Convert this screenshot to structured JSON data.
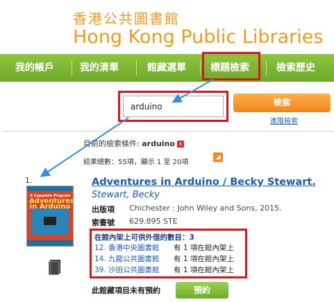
{
  "header": {
    "title_zh": "香港公共圖書館",
    "title_en": "Hong Kong Public Libraries"
  },
  "nav": {
    "items": [
      {
        "label": "我的帳戶"
      },
      {
        "label": "我的清單"
      },
      {
        "label": "館藏選單"
      },
      {
        "label": "標題檢索"
      },
      {
        "label": "檢索歷史"
      }
    ]
  },
  "search": {
    "value": "arduino",
    "button_label": "檢索",
    "advanced_label": "進階檢索"
  },
  "criteria": {
    "prefix": "目前的檢索條件:",
    "term": "arduino",
    "clear_icon": "x"
  },
  "summary": "結果總數：55項，顯示 1 至 20項",
  "result": {
    "number": "1.",
    "title": "Adventures in Arduino / Becky Stewart.",
    "author": "Stewart, Becky",
    "publisher_label": "出版項",
    "publisher_value": "Chichester : John Wiley and Sons, 2015.",
    "callno_label": "索書號",
    "callno_value": "629.895 STE",
    "cover": {
      "top_text": "A Complete Program",
      "big_text": "Adventures in Arduino"
    },
    "availability": {
      "heading": "在館內架上可供外借的數目：3",
      "branches": [
        {
          "branch": "12. 香港中央圖書館",
          "status": "有 1 項在館內架上"
        },
        {
          "branch": "14. 九龍公共圖書館",
          "status": "有 1 項在館內架上"
        },
        {
          "branch": "39. 沙田公共圖書館",
          "status": "有 1 項在館內架上"
        }
      ]
    },
    "hold_note": "此館藏項目未有預約",
    "reserve_label": "預約"
  },
  "colors": {
    "brand_orange": "#f39a1d",
    "nav_green": "#7db836",
    "highlight_red": "#e0151c",
    "link_blue": "#1a5cb5",
    "arrow_blue": "#2f8de4"
  }
}
